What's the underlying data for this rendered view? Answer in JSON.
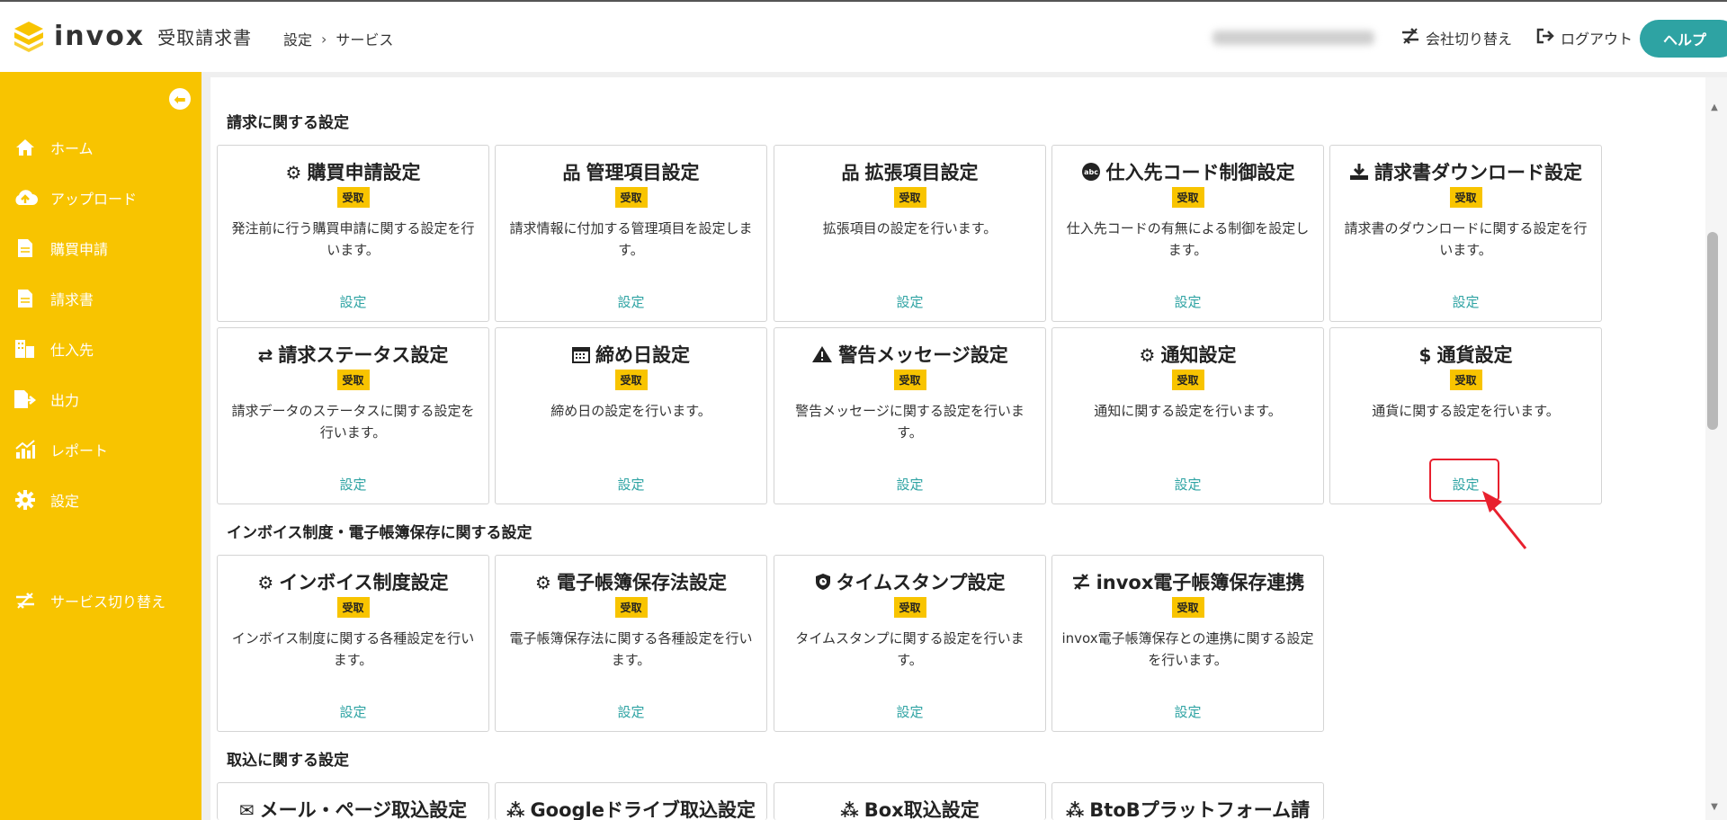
{
  "header": {
    "logo_text": "invox",
    "logo_sub": "受取請求書",
    "breadcrumb": [
      "設定",
      "サービス"
    ],
    "switch_company": "会社切り替え",
    "logout": "ログアウト",
    "help": "ヘルプ"
  },
  "sidebar": {
    "items": [
      {
        "label": "ホーム",
        "icon": "home-icon"
      },
      {
        "label": "アップロード",
        "icon": "cloud-upload-icon"
      },
      {
        "label": "購買申請",
        "icon": "document-icon"
      },
      {
        "label": "請求書",
        "icon": "document-icon"
      },
      {
        "label": "仕入先",
        "icon": "building-icon"
      },
      {
        "label": "出力",
        "icon": "export-icon"
      },
      {
        "label": "レポート",
        "icon": "chart-icon"
      },
      {
        "label": "設定",
        "icon": "gear-icon"
      },
      {
        "label": "サービス切り替え",
        "icon": "switch-icon"
      }
    ]
  },
  "sections": [
    {
      "title": "請求に関する設定",
      "cards": [
        {
          "title": "購買申請設定",
          "icon": "gears-icon",
          "badge": "受取",
          "desc": "発注前に行う購買申請に関する設定を行います。",
          "link": "設定"
        },
        {
          "title": "管理項目設定",
          "icon": "hierarchy-icon",
          "badge": "受取",
          "desc": "請求情報に付加する管理項目を設定します。",
          "link": "設定"
        },
        {
          "title": "拡張項目設定",
          "icon": "hierarchy-icon",
          "badge": "受取",
          "desc": "拡張項目の設定を行います。",
          "link": "設定"
        },
        {
          "title": "仕入先コード制御設定",
          "icon": "abc-icon",
          "badge": "受取",
          "desc": "仕入先コードの有無による制御を設定します。",
          "link": "設定"
        },
        {
          "title": "請求書ダウンロード設定",
          "icon": "download-icon",
          "badge": "受取",
          "desc": "請求書のダウンロードに関する設定を行います。",
          "link": "設定"
        },
        {
          "title": "請求ステータス設定",
          "icon": "status-icon",
          "badge": "受取",
          "desc": "請求データのステータスに関する設定を行います。",
          "link": "設定"
        },
        {
          "title": "締め日設定",
          "icon": "calendar-icon",
          "badge": "受取",
          "desc": "締め日の設定を行います。",
          "link": "設定"
        },
        {
          "title": "警告メッセージ設定",
          "icon": "warning-icon",
          "badge": "受取",
          "desc": "警告メッセージに関する設定を行います。",
          "link": "設定"
        },
        {
          "title": "通知設定",
          "icon": "gears-icon",
          "badge": "受取",
          "desc": "通知に関する設定を行います。",
          "link": "設定"
        },
        {
          "title": "通貨設定",
          "icon": "dollar-icon",
          "badge": "受取",
          "desc": "通貨に関する設定を行います。",
          "link": "設定"
        }
      ]
    },
    {
      "title": "インボイス制度・電子帳簿保存に関する設定",
      "cards": [
        {
          "title": "インボイス制度設定",
          "icon": "gears-icon",
          "badge": "受取",
          "desc": "インボイス制度に関する各種設定を行います。",
          "link": "設定"
        },
        {
          "title": "電子帳簿保存法設定",
          "icon": "gears-icon",
          "badge": "受取",
          "desc": "電子帳簿保存法に関する各種設定を行います。",
          "link": "設定"
        },
        {
          "title": "タイムスタンプ設定",
          "icon": "shield-icon",
          "badge": "受取",
          "desc": "タイムスタンプに関する設定を行います。",
          "link": "設定"
        },
        {
          "title": "invox電子帳簿保存連携",
          "icon": "switch-icon",
          "badge": "受取",
          "desc": "invox電子帳簿保存との連携に関する設定を行います。",
          "link": "設定"
        }
      ]
    },
    {
      "title": "取込に関する設定",
      "cards": [
        {
          "title": "メール・ページ取込設定",
          "icon": "mail-icon"
        },
        {
          "title": "Googleドライブ取込設定",
          "icon": "share-icon"
        },
        {
          "title": "Box取込設定",
          "icon": "share-icon"
        },
        {
          "title": "BtoBプラットフォーム請",
          "icon": "share-icon"
        }
      ]
    }
  ]
}
